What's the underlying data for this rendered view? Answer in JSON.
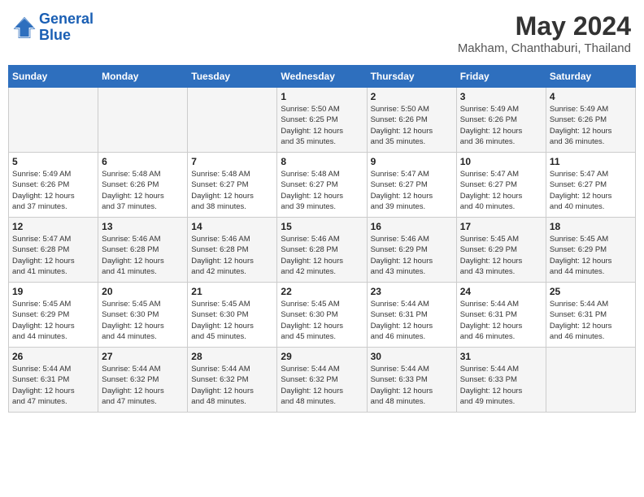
{
  "header": {
    "logo_line1": "General",
    "logo_line2": "Blue",
    "month": "May 2024",
    "location": "Makham, Chanthaburi, Thailand"
  },
  "weekdays": [
    "Sunday",
    "Monday",
    "Tuesday",
    "Wednesday",
    "Thursday",
    "Friday",
    "Saturday"
  ],
  "weeks": [
    [
      {
        "day": "",
        "info": ""
      },
      {
        "day": "",
        "info": ""
      },
      {
        "day": "",
        "info": ""
      },
      {
        "day": "1",
        "info": "Sunrise: 5:50 AM\nSunset: 6:25 PM\nDaylight: 12 hours\nand 35 minutes."
      },
      {
        "day": "2",
        "info": "Sunrise: 5:50 AM\nSunset: 6:26 PM\nDaylight: 12 hours\nand 35 minutes."
      },
      {
        "day": "3",
        "info": "Sunrise: 5:49 AM\nSunset: 6:26 PM\nDaylight: 12 hours\nand 36 minutes."
      },
      {
        "day": "4",
        "info": "Sunrise: 5:49 AM\nSunset: 6:26 PM\nDaylight: 12 hours\nand 36 minutes."
      }
    ],
    [
      {
        "day": "5",
        "info": "Sunrise: 5:49 AM\nSunset: 6:26 PM\nDaylight: 12 hours\nand 37 minutes."
      },
      {
        "day": "6",
        "info": "Sunrise: 5:48 AM\nSunset: 6:26 PM\nDaylight: 12 hours\nand 37 minutes."
      },
      {
        "day": "7",
        "info": "Sunrise: 5:48 AM\nSunset: 6:27 PM\nDaylight: 12 hours\nand 38 minutes."
      },
      {
        "day": "8",
        "info": "Sunrise: 5:48 AM\nSunset: 6:27 PM\nDaylight: 12 hours\nand 39 minutes."
      },
      {
        "day": "9",
        "info": "Sunrise: 5:47 AM\nSunset: 6:27 PM\nDaylight: 12 hours\nand 39 minutes."
      },
      {
        "day": "10",
        "info": "Sunrise: 5:47 AM\nSunset: 6:27 PM\nDaylight: 12 hours\nand 40 minutes."
      },
      {
        "day": "11",
        "info": "Sunrise: 5:47 AM\nSunset: 6:27 PM\nDaylight: 12 hours\nand 40 minutes."
      }
    ],
    [
      {
        "day": "12",
        "info": "Sunrise: 5:47 AM\nSunset: 6:28 PM\nDaylight: 12 hours\nand 41 minutes."
      },
      {
        "day": "13",
        "info": "Sunrise: 5:46 AM\nSunset: 6:28 PM\nDaylight: 12 hours\nand 41 minutes."
      },
      {
        "day": "14",
        "info": "Sunrise: 5:46 AM\nSunset: 6:28 PM\nDaylight: 12 hours\nand 42 minutes."
      },
      {
        "day": "15",
        "info": "Sunrise: 5:46 AM\nSunset: 6:28 PM\nDaylight: 12 hours\nand 42 minutes."
      },
      {
        "day": "16",
        "info": "Sunrise: 5:46 AM\nSunset: 6:29 PM\nDaylight: 12 hours\nand 43 minutes."
      },
      {
        "day": "17",
        "info": "Sunrise: 5:45 AM\nSunset: 6:29 PM\nDaylight: 12 hours\nand 43 minutes."
      },
      {
        "day": "18",
        "info": "Sunrise: 5:45 AM\nSunset: 6:29 PM\nDaylight: 12 hours\nand 44 minutes."
      }
    ],
    [
      {
        "day": "19",
        "info": "Sunrise: 5:45 AM\nSunset: 6:29 PM\nDaylight: 12 hours\nand 44 minutes."
      },
      {
        "day": "20",
        "info": "Sunrise: 5:45 AM\nSunset: 6:30 PM\nDaylight: 12 hours\nand 44 minutes."
      },
      {
        "day": "21",
        "info": "Sunrise: 5:45 AM\nSunset: 6:30 PM\nDaylight: 12 hours\nand 45 minutes."
      },
      {
        "day": "22",
        "info": "Sunrise: 5:45 AM\nSunset: 6:30 PM\nDaylight: 12 hours\nand 45 minutes."
      },
      {
        "day": "23",
        "info": "Sunrise: 5:44 AM\nSunset: 6:31 PM\nDaylight: 12 hours\nand 46 minutes."
      },
      {
        "day": "24",
        "info": "Sunrise: 5:44 AM\nSunset: 6:31 PM\nDaylight: 12 hours\nand 46 minutes."
      },
      {
        "day": "25",
        "info": "Sunrise: 5:44 AM\nSunset: 6:31 PM\nDaylight: 12 hours\nand 46 minutes."
      }
    ],
    [
      {
        "day": "26",
        "info": "Sunrise: 5:44 AM\nSunset: 6:31 PM\nDaylight: 12 hours\nand 47 minutes."
      },
      {
        "day": "27",
        "info": "Sunrise: 5:44 AM\nSunset: 6:32 PM\nDaylight: 12 hours\nand 47 minutes."
      },
      {
        "day": "28",
        "info": "Sunrise: 5:44 AM\nSunset: 6:32 PM\nDaylight: 12 hours\nand 48 minutes."
      },
      {
        "day": "29",
        "info": "Sunrise: 5:44 AM\nSunset: 6:32 PM\nDaylight: 12 hours\nand 48 minutes."
      },
      {
        "day": "30",
        "info": "Sunrise: 5:44 AM\nSunset: 6:33 PM\nDaylight: 12 hours\nand 48 minutes."
      },
      {
        "day": "31",
        "info": "Sunrise: 5:44 AM\nSunset: 6:33 PM\nDaylight: 12 hours\nand 49 minutes."
      },
      {
        "day": "",
        "info": ""
      }
    ]
  ]
}
